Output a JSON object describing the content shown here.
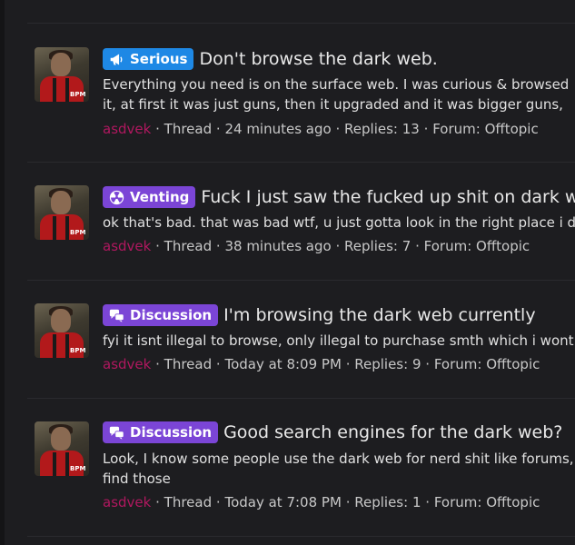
{
  "threads": [
    {
      "prefix": "Serious",
      "prefix_icon": "megaphone-icon",
      "title": "Don't browse the dark web.",
      "snippet": "Everything you need is on the surface web. I was curious & browsed it, at first it was just guns, then it upgraded and it was bigger guns, grenade launchers, then it got upgraded",
      "author": "asdvek",
      "type": "Thread",
      "time": "24 minutes ago",
      "replies": "Replies: 13",
      "forum": "Forum: Offtopic"
    },
    {
      "prefix": "Venting",
      "prefix_icon": "radiation-icon",
      "title": "Fuck I just saw the fucked up shit on dark web",
      "snippet": "ok that's bad. that was bad wtf, u just gotta look in the right place i did and",
      "author": "asdvek",
      "type": "Thread",
      "time": "38 minutes ago",
      "replies": "Replies: 7",
      "forum": "Forum: Offtopic"
    },
    {
      "prefix": "Discussion",
      "prefix_icon": "chat-bubbles-icon",
      "title": "I'm browsing the dark web currently",
      "snippet": "fyi it isnt illegal to browse, only illegal to purchase smth which i wont be doing",
      "author": "asdvek",
      "type": "Thread",
      "time": "Today at 8:09 PM",
      "replies": "Replies: 9",
      "forum": "Forum: Offtopic"
    },
    {
      "prefix": "Discussion",
      "prefix_icon": "chat-bubbles-icon",
      "title": "Good search engines for the dark web?",
      "snippet_line1": "Look, I know some people use the dark web for nerd shit like forums, webs",
      "snippet_line2": "find those",
      "author": "asdvek",
      "type": "Thread",
      "time": "Today at 7:08 PM",
      "replies": "Replies: 1",
      "forum": "Forum: Offtopic"
    }
  ],
  "separator": "·",
  "colors": {
    "serious": "#1e88e5",
    "venting": "#7b45d6",
    "discussion": "#7b45d6",
    "author": "#b0185f",
    "background": "#1d1d20"
  }
}
